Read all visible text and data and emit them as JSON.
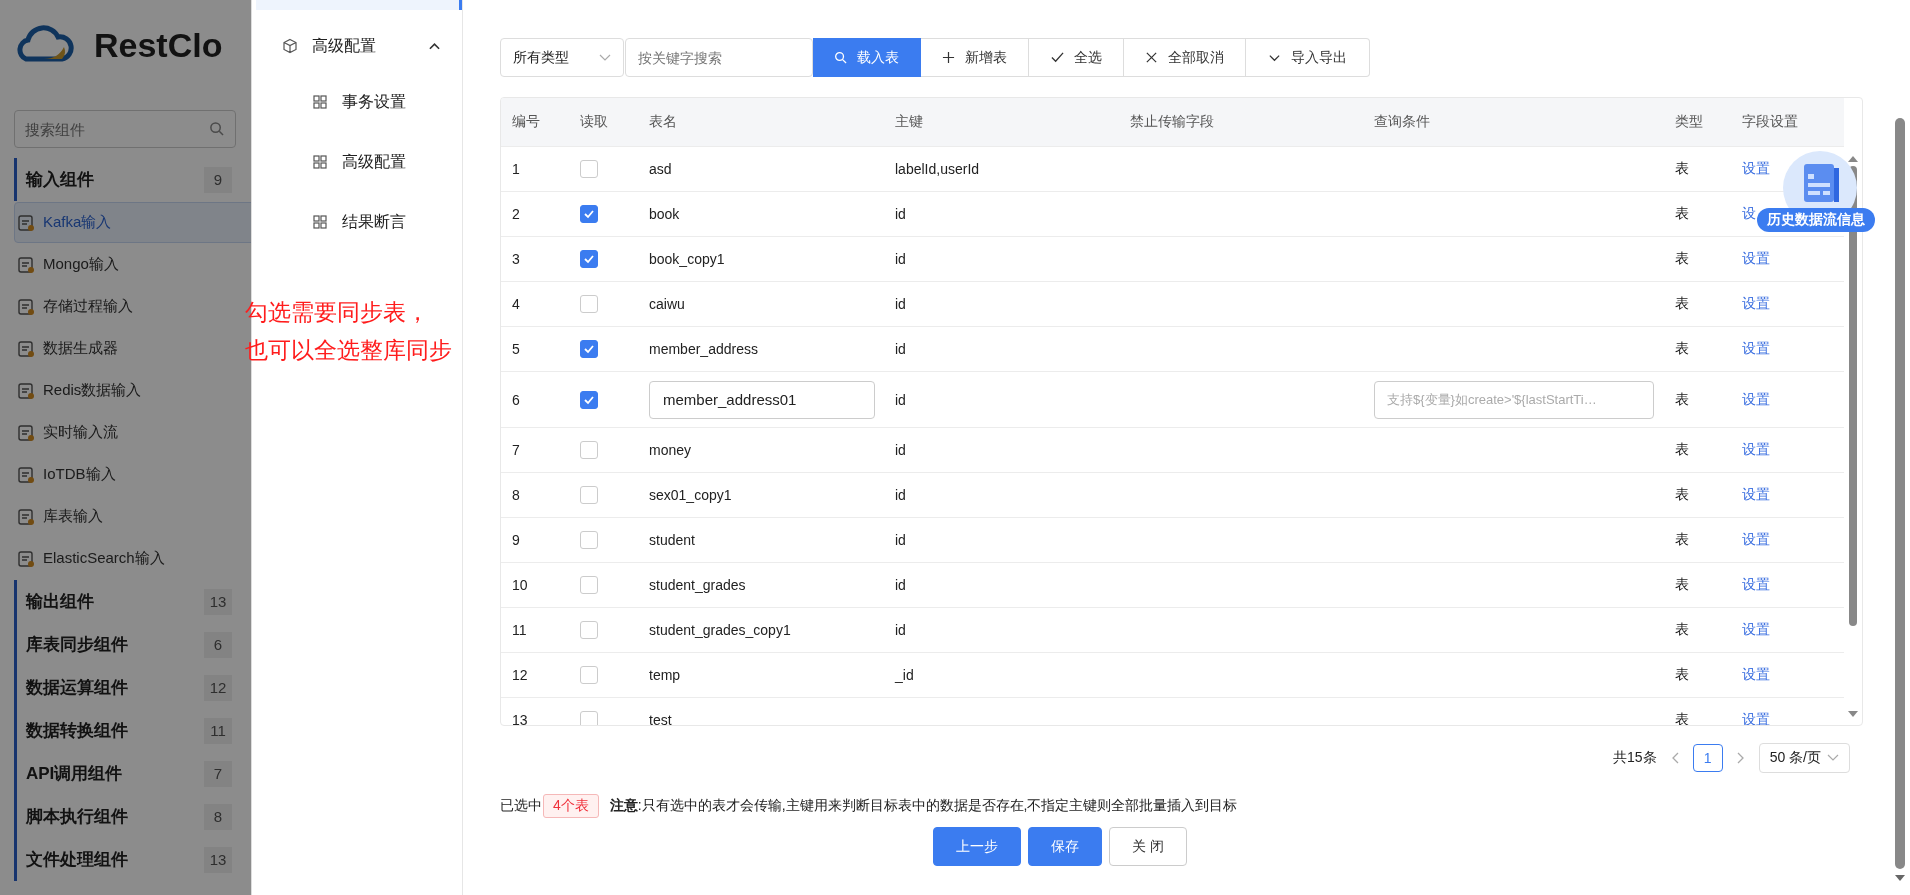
{
  "sidebar": {
    "logo": "RestClo",
    "search_placeholder": "搜索组件",
    "groups": [
      {
        "label": "输入组件",
        "count": "9",
        "items": [
          {
            "label": "Kafka输入",
            "selected": true
          },
          {
            "label": "Mongo输入",
            "selected": false
          },
          {
            "label": "存储过程输入",
            "selected": false
          },
          {
            "label": "数据生成器",
            "selected": false
          },
          {
            "label": "Redis数据输入",
            "selected": false
          },
          {
            "label": "实时输入流",
            "selected": false
          },
          {
            "label": "IoTDB输入",
            "selected": false
          },
          {
            "label": "库表输入",
            "selected": false
          },
          {
            "label": "ElasticSearch输入",
            "selected": false
          }
        ]
      },
      {
        "label": "输出组件",
        "count": "13"
      },
      {
        "label": "库表同步组件",
        "count": "6"
      },
      {
        "label": "数据运算组件",
        "count": "12"
      },
      {
        "label": "数据转换组件",
        "count": "11"
      },
      {
        "label": "API调用组件",
        "count": "7"
      },
      {
        "label": "脚本执行组件",
        "count": "8"
      },
      {
        "label": "文件处理组件",
        "count": "13"
      }
    ]
  },
  "drawer_menu": {
    "label": "高级配置",
    "expanded": true,
    "items": [
      {
        "label": "事务设置"
      },
      {
        "label": "高级配置"
      },
      {
        "label": "结果断言"
      }
    ]
  },
  "annotation": [
    "勾选需要同步表，",
    "也可以全选整库同步"
  ],
  "toolbar": {
    "type_select": "所有类型",
    "search_placeholder": "按关键字搜索",
    "buttons": [
      {
        "label": "载入表",
        "kind": "search",
        "primary": true
      },
      {
        "label": "新增表",
        "kind": "add",
        "primary": false
      },
      {
        "label": "全选",
        "kind": "check",
        "primary": false
      },
      {
        "label": "全部取消",
        "kind": "clear",
        "primary": false
      },
      {
        "label": "导入导出",
        "kind": "dropdown",
        "primary": false
      }
    ]
  },
  "table": {
    "columns": [
      "编号",
      "读取",
      "表名",
      "主键",
      "禁止传输字段",
      "查询条件",
      "类型",
      "字段设置"
    ],
    "rows": [
      {
        "no": "1",
        "read": false,
        "name": "asd",
        "editing": false,
        "key": "labelId,userId",
        "type": "表",
        "action": "设置"
      },
      {
        "no": "2",
        "read": true,
        "name": "book",
        "editing": false,
        "key": "id",
        "type": "表",
        "action": "设"
      },
      {
        "no": "3",
        "read": true,
        "name": "book_copy1",
        "editing": false,
        "key": "id",
        "type": "表",
        "action": "设置"
      },
      {
        "no": "4",
        "read": false,
        "name": "caiwu",
        "editing": false,
        "key": "id",
        "type": "表",
        "action": "设置"
      },
      {
        "no": "5",
        "read": true,
        "name": "member_address",
        "editing": false,
        "key": "id",
        "type": "表",
        "action": "设置"
      },
      {
        "no": "6",
        "read": true,
        "name": "member_address01",
        "editing": true,
        "key": "id",
        "query_placeholder": "支持${变量}如create>'${lastStartTi…",
        "type": "表",
        "action": "设置"
      },
      {
        "no": "7",
        "read": false,
        "name": "money",
        "editing": false,
        "key": "id",
        "type": "表",
        "action": "设置"
      },
      {
        "no": "8",
        "read": false,
        "name": "sex01_copy1",
        "editing": false,
        "key": "id",
        "type": "表",
        "action": "设置"
      },
      {
        "no": "9",
        "read": false,
        "name": "student",
        "editing": false,
        "key": "id",
        "type": "表",
        "action": "设置"
      },
      {
        "no": "10",
        "read": false,
        "name": "student_grades",
        "editing": false,
        "key": "id",
        "type": "表",
        "action": "设置"
      },
      {
        "no": "11",
        "read": false,
        "name": "student_grades_copy1",
        "editing": false,
        "key": "id",
        "type": "表",
        "action": "设置"
      },
      {
        "no": "12",
        "read": false,
        "name": "temp",
        "editing": false,
        "key": "_id",
        "type": "表",
        "action": "设置"
      },
      {
        "no": "13",
        "read": false,
        "name": "test",
        "editing": false,
        "type": "表",
        "action": "设置"
      }
    ]
  },
  "float_badge": "历史数据流信息",
  "pagination": {
    "total": "共15条",
    "pages": [
      {
        "label": "1",
        "selected": true
      }
    ],
    "page_size": "50 条/页"
  },
  "footer": {
    "selected_prefix": "已选中",
    "selected_count": "4个表",
    "note": "**注意**:只有选中的表才会传输,主键用来判断目标表中的数据是否存在,不指定主键则全部批量插入到目标"
  },
  "buttons": [
    {
      "label": "上一步",
      "kind": "primary"
    },
    {
      "label": "保存",
      "kind": "primary"
    },
    {
      "label": "关 闭",
      "kind": "default"
    }
  ]
}
